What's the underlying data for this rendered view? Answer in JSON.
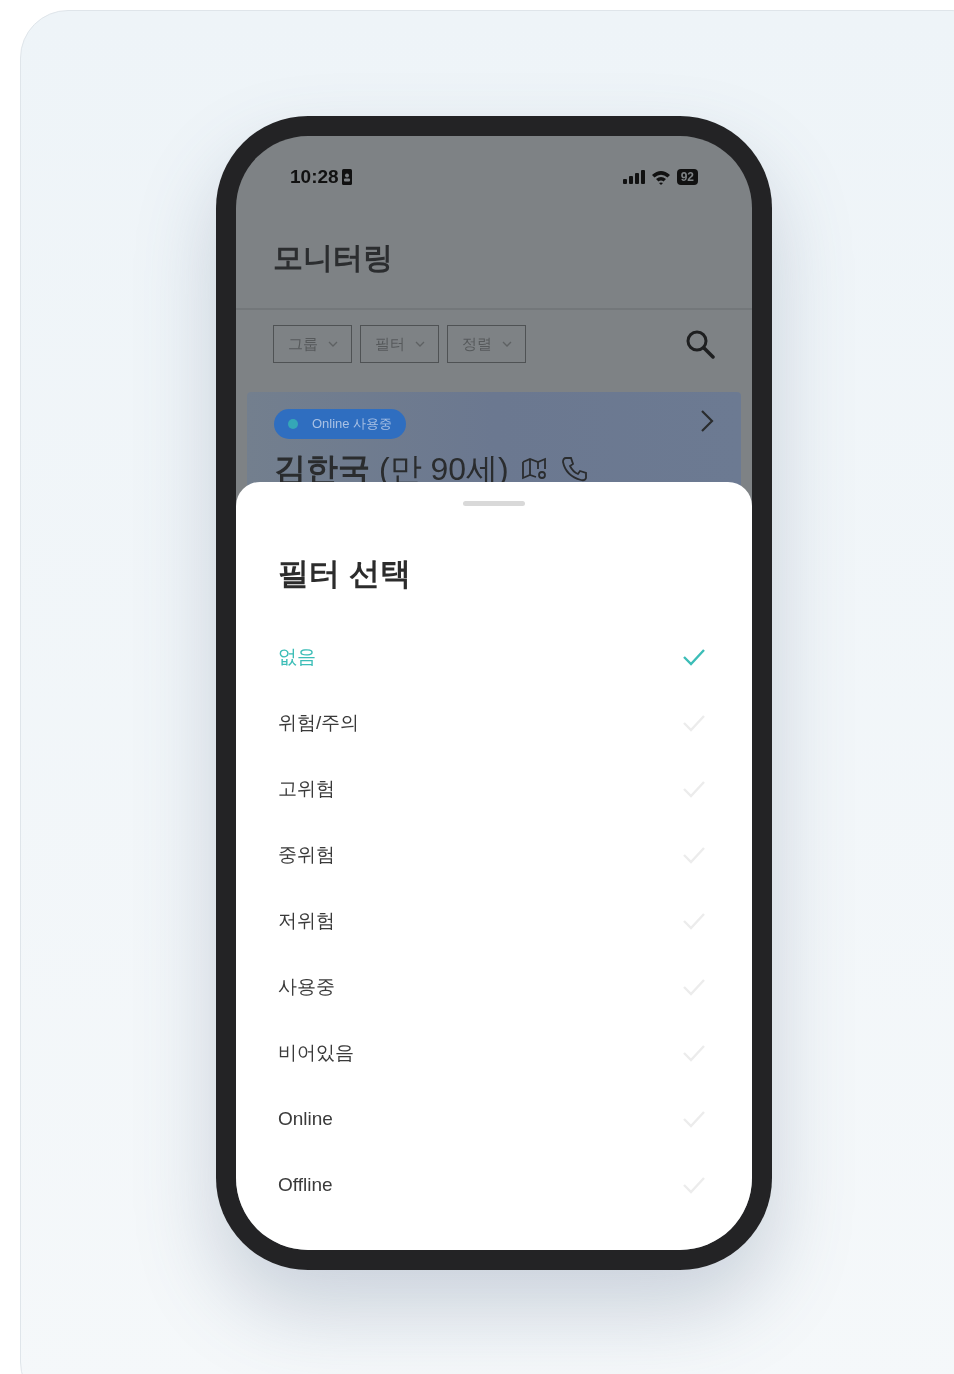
{
  "status_bar": {
    "time": "10:28",
    "battery": "92"
  },
  "header": {
    "title": "모니터링"
  },
  "toolbar": {
    "dropdowns": [
      {
        "label": "그룹"
      },
      {
        "label": "필터"
      },
      {
        "label": "정렬"
      }
    ]
  },
  "card": {
    "badge": "Online 사용중",
    "name": "**김한국** (만 90세)"
  },
  "sheet": {
    "title": "필터 선택",
    "options": [
      {
        "label": "없음",
        "selected": true
      },
      {
        "label": "위험/주의",
        "selected": false
      },
      {
        "label": "고위험",
        "selected": false
      },
      {
        "label": "중위험",
        "selected": false
      },
      {
        "label": "저위험",
        "selected": false
      },
      {
        "label": "사용중",
        "selected": false
      },
      {
        "label": "비어있음",
        "selected": false
      },
      {
        "label": "Online",
        "selected": false
      },
      {
        "label": "Offline",
        "selected": false
      }
    ]
  }
}
